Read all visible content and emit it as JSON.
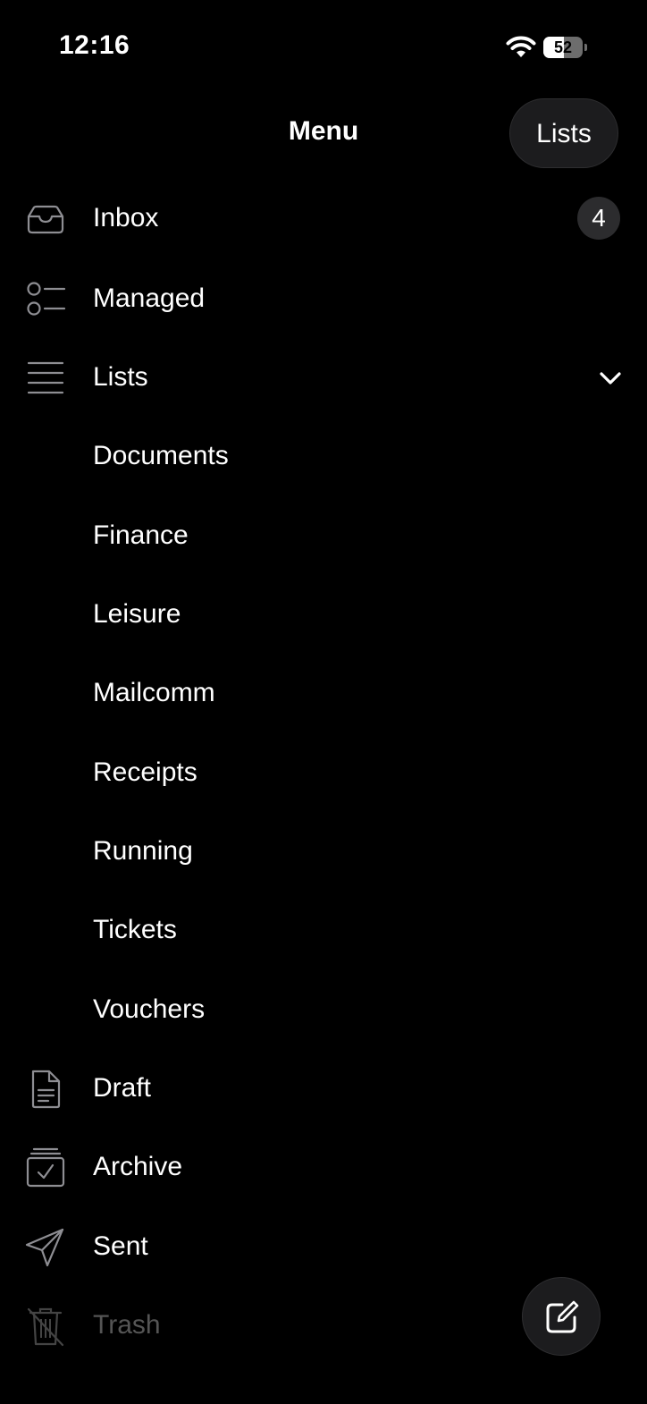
{
  "status_bar": {
    "time": "12:16",
    "battery_level": "52",
    "battery_fraction": 0.52
  },
  "header": {
    "title": "Menu",
    "lists_button_label": "Lists"
  },
  "menu": {
    "inbox": {
      "label": "Inbox",
      "badge": "4",
      "icon": "inbox-tray-icon"
    },
    "managed": {
      "label": "Managed",
      "icon": "checklist-icon"
    },
    "lists": {
      "label": "Lists",
      "icon": "list-lines-icon",
      "expanded": true,
      "items": [
        {
          "label": "Documents"
        },
        {
          "label": "Finance"
        },
        {
          "label": "Leisure"
        },
        {
          "label": "Mailcomm"
        },
        {
          "label": "Receipts"
        },
        {
          "label": "Running"
        },
        {
          "label": "Tickets"
        },
        {
          "label": "Vouchers"
        }
      ]
    },
    "draft": {
      "label": "Draft",
      "icon": "document-icon"
    },
    "archive": {
      "label": "Archive",
      "icon": "archive-box-icon"
    },
    "sent": {
      "label": "Sent",
      "icon": "paper-plane-icon"
    },
    "trash": {
      "label": "Trash",
      "icon": "trash-icon"
    }
  },
  "colors": {
    "background": "#000000",
    "text": "#ffffff",
    "button_background": "#1c1c1e",
    "dim_text": "#555555"
  }
}
